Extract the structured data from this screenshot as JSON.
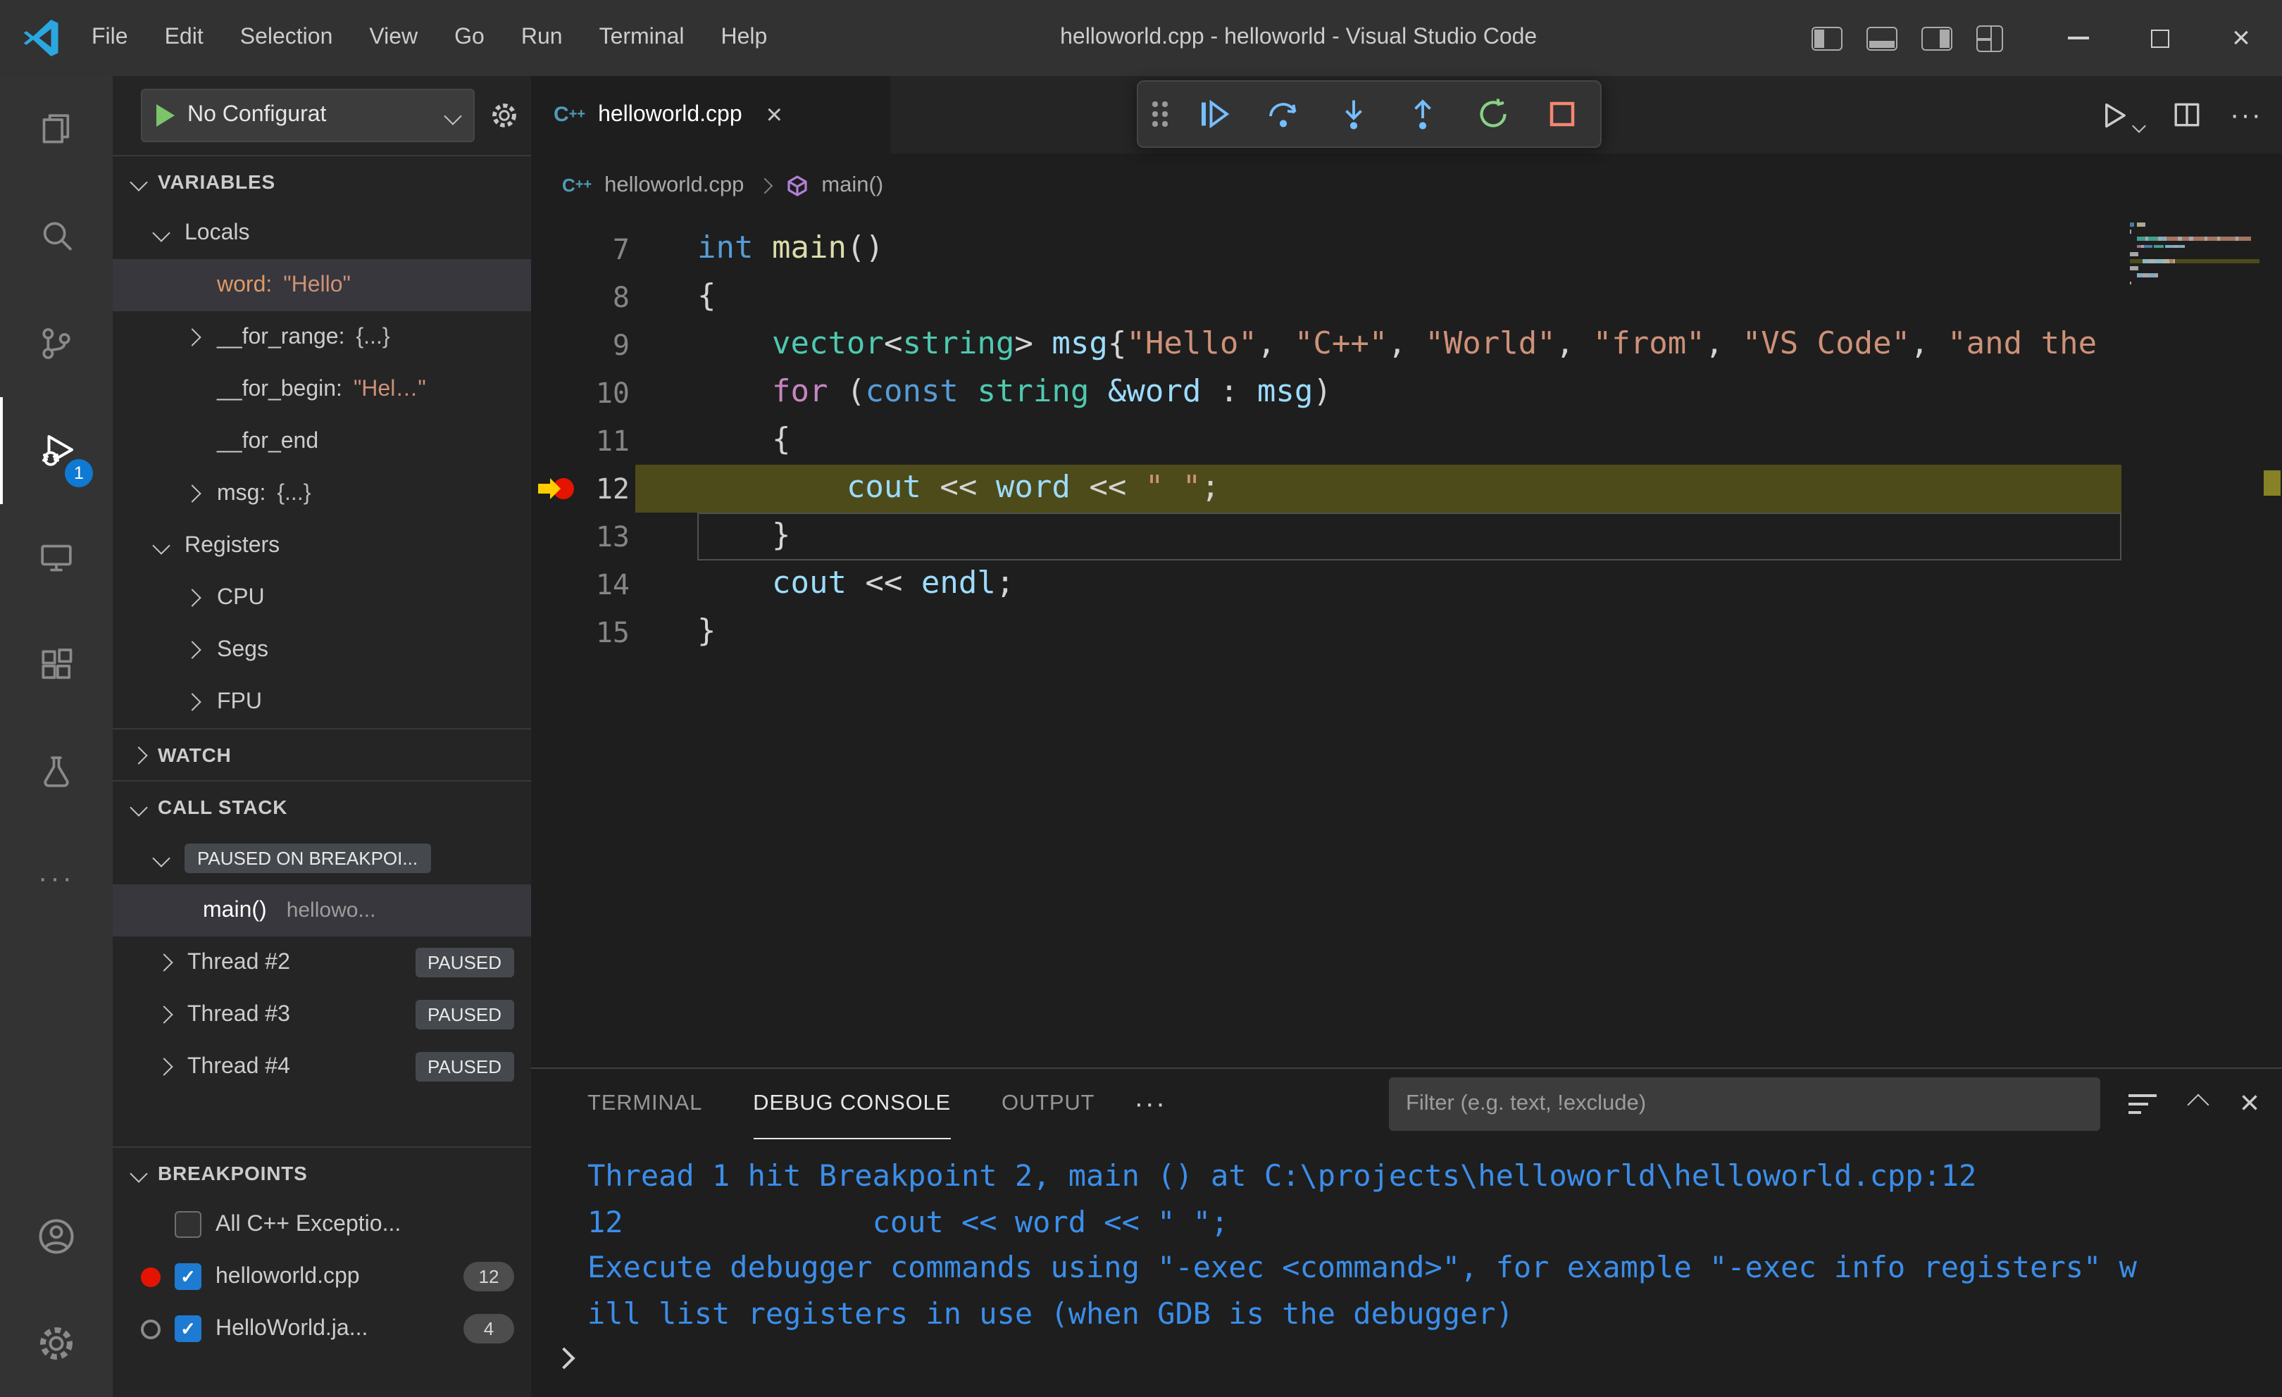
{
  "titlebar": {
    "menus": [
      "File",
      "Edit",
      "Selection",
      "View",
      "Go",
      "Run",
      "Terminal",
      "Help"
    ],
    "title": "helloworld.cpp - helloworld - Visual Studio Code"
  },
  "icons": {
    "check": "✓",
    "close": "×",
    "more": "···"
  },
  "activity_bar": {
    "debug_badge": "1"
  },
  "run_panel": {
    "config_label": "No Configurat",
    "sections": {
      "variables": "VARIABLES",
      "watch": "WATCH",
      "call_stack": "CALL STACK",
      "breakpoints": "BREAKPOINTS"
    },
    "locals_label": "Locals",
    "variables": [
      {
        "name": "word:",
        "value": "\"Hello\"",
        "kind": "string",
        "selected": true,
        "expandable": false,
        "accent": true
      },
      {
        "name": "__for_range:",
        "value": "{...}",
        "kind": "object",
        "selected": false,
        "expandable": true,
        "accent": false
      },
      {
        "name": "__for_begin:",
        "value": "\"Hel…\"",
        "kind": "string",
        "selected": false,
        "expandable": false,
        "accent": false
      },
      {
        "name": "__for_end",
        "value": "",
        "kind": "none",
        "selected": false,
        "expandable": false,
        "accent": false
      },
      {
        "name": "msg:",
        "value": "{...}",
        "kind": "object",
        "selected": false,
        "expandable": true,
        "accent": false
      }
    ],
    "registers_label": "Registers",
    "registers": [
      "CPU",
      "Segs",
      "FPU"
    ],
    "call_stack": {
      "paused_badge": "PAUSED ON BREAKPOI...",
      "frame_name": "main()",
      "frame_file": "hellowo...",
      "threads": [
        {
          "name": "Thread #2",
          "badge": "PAUSED"
        },
        {
          "name": "Thread #3",
          "badge": "PAUSED"
        },
        {
          "name": "Thread #4",
          "badge": "PAUSED"
        }
      ]
    },
    "breakpoints": [
      {
        "label": "All C++ Exceptio...",
        "checked": false,
        "dot": "none",
        "count": ""
      },
      {
        "label": "helloworld.cpp",
        "checked": true,
        "dot": "red",
        "count": "12"
      },
      {
        "label": "HelloWorld.ja...",
        "checked": true,
        "dot": "gray",
        "count": "4"
      }
    ]
  },
  "editor": {
    "tab_label": "helloworld.cpp",
    "breadcrumb_file": "helloworld.cpp",
    "breadcrumb_symbol": "main()",
    "lines": [
      {
        "num": 7,
        "tokens": [
          [
            "int",
            "kw"
          ],
          [
            " ",
            "pl"
          ],
          [
            "main",
            "fn"
          ],
          [
            "()",
            "pl"
          ]
        ]
      },
      {
        "num": 8,
        "tokens": [
          [
            "{",
            "pl"
          ]
        ]
      },
      {
        "num": 9,
        "tokens": [
          [
            "    ",
            "pl"
          ],
          [
            "vector",
            "ty"
          ],
          [
            "<",
            "pl"
          ],
          [
            "string",
            "ty"
          ],
          [
            "> ",
            "pl"
          ],
          [
            "msg",
            "va"
          ],
          [
            "{",
            "pl"
          ],
          [
            "\"Hello\"",
            "st"
          ],
          [
            ", ",
            "pl"
          ],
          [
            "\"C++\"",
            "st"
          ],
          [
            ", ",
            "pl"
          ],
          [
            "\"World\"",
            "st"
          ],
          [
            ", ",
            "pl"
          ],
          [
            "\"from\"",
            "st"
          ],
          [
            ", ",
            "pl"
          ],
          [
            "\"VS Code\"",
            "st"
          ],
          [
            ", ",
            "pl"
          ],
          [
            "\"and the",
            "st"
          ]
        ]
      },
      {
        "num": 10,
        "tokens": [
          [
            "    ",
            "pl"
          ],
          [
            "for",
            "ct"
          ],
          [
            " (",
            "pl"
          ],
          [
            "const",
            "kw"
          ],
          [
            " ",
            "pl"
          ],
          [
            "string",
            "ty"
          ],
          [
            " ",
            "pl"
          ],
          [
            "&word",
            "va"
          ],
          [
            " : ",
            "pl"
          ],
          [
            "msg",
            "va"
          ],
          [
            ")",
            "pl"
          ]
        ]
      },
      {
        "num": 11,
        "tokens": [
          [
            "    {",
            "pl"
          ]
        ]
      },
      {
        "num": 12,
        "current": true,
        "bp": "current",
        "tokens": [
          [
            "        ",
            "pl"
          ],
          [
            "cout",
            "va"
          ],
          [
            " << ",
            "pl"
          ],
          [
            "word",
            "va"
          ],
          [
            " << ",
            "pl"
          ],
          [
            "\" \"",
            "st"
          ],
          [
            ";",
            "pl"
          ]
        ]
      },
      {
        "num": 13,
        "cursor": true,
        "tokens": [
          [
            "    }",
            "pl"
          ]
        ]
      },
      {
        "num": 14,
        "tokens": [
          [
            "    ",
            "pl"
          ],
          [
            "cout",
            "va"
          ],
          [
            " << ",
            "pl"
          ],
          [
            "endl",
            "va"
          ],
          [
            ";",
            "pl"
          ]
        ]
      },
      {
        "num": 15,
        "tokens": [
          [
            "}",
            "pl"
          ]
        ]
      }
    ]
  },
  "panel": {
    "tabs": [
      {
        "label": "TERMINAL",
        "active": false
      },
      {
        "label": "DEBUG CONSOLE",
        "active": true
      },
      {
        "label": "OUTPUT",
        "active": false
      }
    ],
    "filter_placeholder": "Filter (e.g. text, !exclude)",
    "console_lines": [
      "Thread 1 hit Breakpoint 2, main () at C:\\projects\\helloworld\\helloworld.cpp:12",
      "12              cout << word << \" \";",
      "Execute debugger commands using \"-exec <command>\", for example \"-exec info registers\" w",
      "ill list registers in use (when GDB is the debugger)"
    ]
  }
}
